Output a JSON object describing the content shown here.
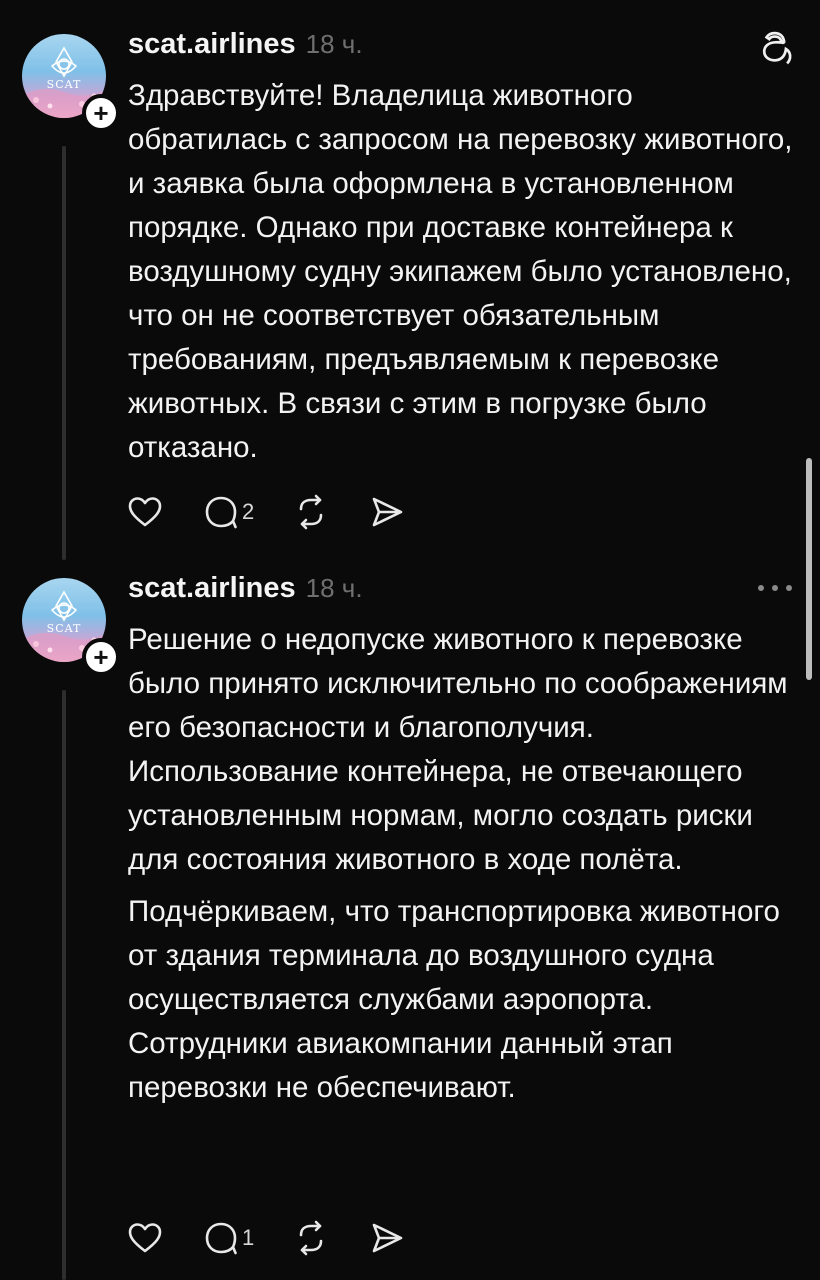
{
  "posts": [
    {
      "username": "scat.airlines",
      "time": "18 ч.",
      "avatar_icon": "scat-logo-avatar",
      "follow_icon": "plus-icon",
      "header_icon": "threads-logo-icon",
      "paragraphs": [
        "Здравствуйте! Владелица животного обратилась с запросом на перевозку животного, и заявка была оформлена в установленном порядке. Однако при доставке контейнера к воздушному судну экипажем было установлено, что он не соответствует обязательным требованиям, предъявляемым к перевозке животных. В связи с этим в погрузке было отказано."
      ],
      "actions": {
        "like_count": "",
        "reply_count": "2"
      }
    },
    {
      "username": "scat.airlines",
      "time": "18 ч.",
      "avatar_icon": "scat-logo-avatar",
      "follow_icon": "plus-icon",
      "header_icon": "more-icon",
      "paragraphs": [
        "Решение о недопуске животного к перевозке было принято исключительно по соображениям его безопасности и благополучия. Использование контейнера, не отвечающего установленным нормам, могло создать риски для состояния животного в ходе полёта.",
        "Подчёркиваем, что транспортировка животного от здания терминала до воздушного судна осуществляется службами аэропорта. Сотрудники авиакомпании данный этап перевозки не обеспечивают."
      ],
      "actions": {
        "like_count": "",
        "reply_count": "1"
      }
    }
  ],
  "colors": {
    "background": "#0a0a0a",
    "text": "#f3f3f3",
    "muted": "#6f6f6f",
    "thread_line": "#2e2e2e"
  }
}
